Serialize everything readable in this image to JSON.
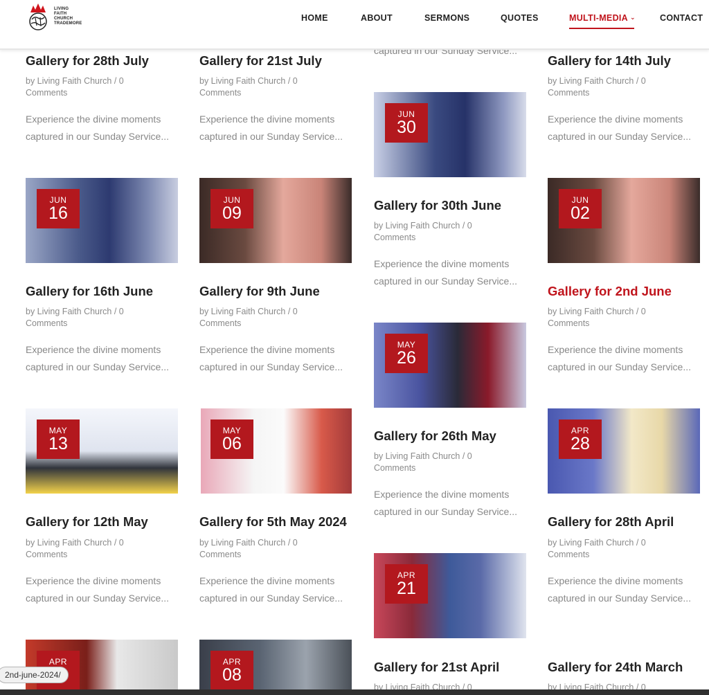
{
  "brand": {
    "name_lines": [
      "LIVING",
      "FAITH",
      "CHURCH",
      "TRADEMORE"
    ],
    "accent": "#c0141c",
    "badge_color": "#b3181e"
  },
  "nav": {
    "items": [
      "HOME",
      "ABOUT",
      "SERMONS",
      "QUOTES",
      "MULTI-MEDIA",
      "CONTACT"
    ],
    "active": "MULTI-MEDIA"
  },
  "posts": [
    {
      "title": "Gallery for 28th July",
      "meta_line1": "by Living Faith Church / 0",
      "meta_line2": "Comments",
      "excerpt1": "Experience the divine moments",
      "excerpt2": "captured in our Sunday Service..."
    },
    {
      "title": "Gallery for 21st July",
      "meta_line1": "by Living Faith Church / 0",
      "meta_line2": "Comments",
      "excerpt1": "Experience the divine moments",
      "excerpt2": "captured in our Sunday Service..."
    },
    {
      "title": "Gallery for 14th July",
      "meta_line1": "by Living Faith Church / 0",
      "meta_line2": "Comments",
      "excerpt1": "Experience the divine moments",
      "excerpt2": "captured in our Sunday Service..."
    },
    {
      "month": "JUN",
      "day": "30",
      "title": "Gallery for 30th June",
      "meta_line1": "by Living Faith Church / 0",
      "meta_line2": "Comments",
      "excerpt1": "Experience the divine moments",
      "excerpt2": "captured in our Sunday Service..."
    },
    {
      "month": "JUN",
      "day": "16",
      "title": "Gallery for 16th June",
      "meta_line1": "by Living Faith Church / 0",
      "meta_line2": "Comments",
      "excerpt1": "Experience the divine moments",
      "excerpt2": "captured in our Sunday Service..."
    },
    {
      "month": "JUN",
      "day": "09",
      "title": "Gallery for 9th June",
      "meta_line1": "by Living Faith Church / 0",
      "meta_line2": "Comments",
      "excerpt1": "Experience the divine moments",
      "excerpt2": "captured in our Sunday Service..."
    },
    {
      "month": "JUN",
      "day": "02",
      "title": "Gallery for 2nd June",
      "meta_line1": "by Living Faith Church / 0",
      "meta_line2": "Comments",
      "excerpt1": "Experience the divine moments",
      "excerpt2": "captured in our Sunday Service..."
    },
    {
      "month": "MAY",
      "day": "26",
      "title": "Gallery for 26th May",
      "meta_line1": "by Living Faith Church / 0",
      "meta_line2": "Comments",
      "excerpt1": "Experience the divine moments",
      "excerpt2": "captured in our Sunday Service..."
    },
    {
      "month": "MAY",
      "day": "13",
      "title": "Gallery for 12th May",
      "meta_line1": "by Living Faith Church / 0",
      "meta_line2": "Comments",
      "excerpt1": "Experience the divine moments",
      "excerpt2": "captured in our Sunday Service..."
    },
    {
      "month": "MAY",
      "day": "06",
      "title": "Gallery for 5th May 2024",
      "meta_line1": "by Living Faith Church / 0",
      "meta_line2": "Comments",
      "excerpt1": "Experience the divine moments",
      "excerpt2": "captured in our Sunday Service..."
    },
    {
      "month": "APR",
      "day": "28",
      "title": "Gallery for 28th April",
      "meta_line1": "by Living Faith Church / 0",
      "meta_line2": "Comments",
      "excerpt1": "Experience the divine moments",
      "excerpt2": "captured in our Sunday Service..."
    },
    {
      "month": "APR",
      "day": "21",
      "title": "Gallery for 21st April",
      "meta_line1": "by Living Faith Church / 0"
    },
    {
      "month": "APR",
      "day": ""
    },
    {
      "month": "APR",
      "day": "08"
    },
    {
      "title": "Gallery for 24th March",
      "meta_line1": "by Living Faith Church / 0"
    },
    {
      "excerpt2": "captured in our Sunday Service..."
    }
  ],
  "status_url": "2nd-june-2024/"
}
